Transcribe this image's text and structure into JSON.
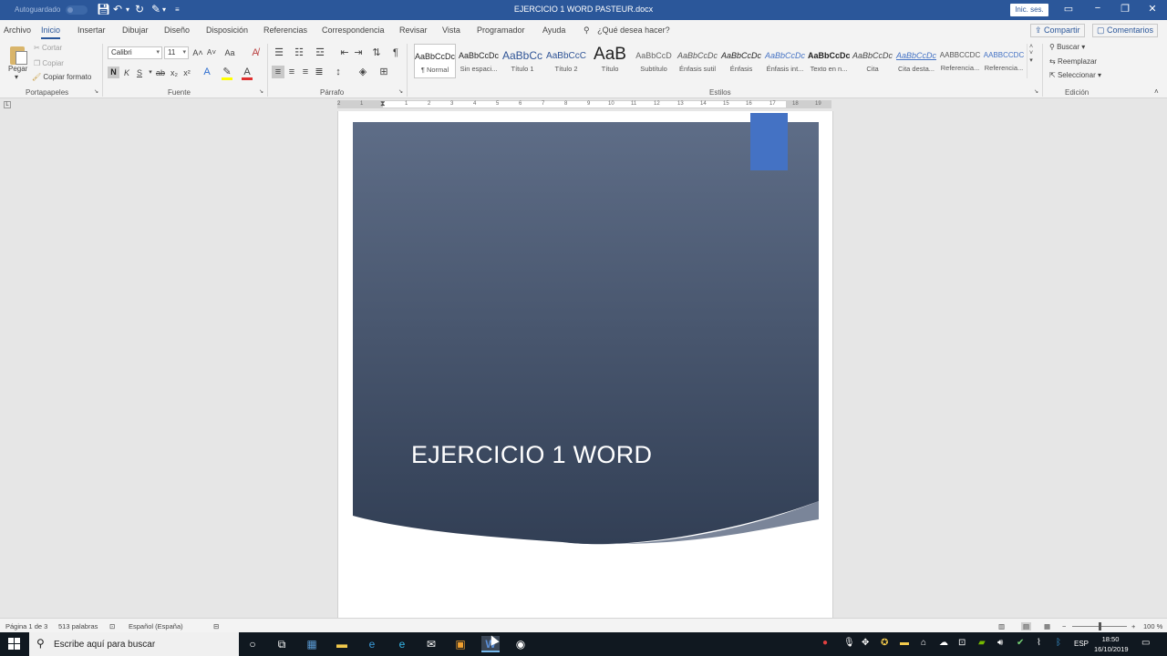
{
  "titlebar": {
    "autosave_label": "Autoguardado",
    "doc_title": "EJERCICIO 1 WORD PASTEUR.docx",
    "signin_label": "Inic. ses."
  },
  "tabs": {
    "items": [
      "Archivo",
      "Inicio",
      "Insertar",
      "Dibujar",
      "Diseño",
      "Disposición",
      "Referencias",
      "Correspondencia",
      "Revisar",
      "Vista",
      "Programador",
      "Ayuda"
    ],
    "active": "Inicio",
    "tell_me": "¿Qué desea hacer?",
    "share": "Compartir",
    "comments": "Comentarios"
  },
  "ribbon": {
    "clipboard": {
      "paste": "Pegar",
      "cut": "Cortar",
      "copy": "Copiar",
      "format_painter": "Copiar formato",
      "group": "Portapapeles"
    },
    "font": {
      "family": "Calibri",
      "size": "11",
      "group": "Fuente",
      "bold": "N",
      "italic": "K",
      "underline": "S"
    },
    "paragraph": {
      "group": "Párrafo"
    },
    "styles": {
      "group": "Estilos",
      "items": [
        {
          "preview": "AaBbCcDc",
          "name": "¶ Normal"
        },
        {
          "preview": "AaBbCcDc",
          "name": "Sin espaci..."
        },
        {
          "preview": "AaBbCc",
          "name": "Título 1"
        },
        {
          "preview": "AaBbCcC",
          "name": "Título 2"
        },
        {
          "preview": "AaB",
          "name": "Título"
        },
        {
          "preview": "AaBbCcD",
          "name": "Subtítulo"
        },
        {
          "preview": "AaBbCcDc",
          "name": "Énfasis sutil"
        },
        {
          "preview": "AaBbCcDc",
          "name": "Énfasis"
        },
        {
          "preview": "AaBbCcDc",
          "name": "Énfasis int..."
        },
        {
          "preview": "AaBbCcDc",
          "name": "Texto en n..."
        },
        {
          "preview": "AaBbCcDc",
          "name": "Cita"
        },
        {
          "preview": "AaBbCcDc",
          "name": "Cita desta..."
        },
        {
          "preview": "AaBbCcDc",
          "name": "Referencia..."
        },
        {
          "preview": "AaBbCcDc",
          "name": "Referencia..."
        }
      ]
    },
    "editing": {
      "find": "Buscar",
      "replace": "Reemplazar",
      "select": "Seleccionar",
      "group": "Edición"
    }
  },
  "ruler": {
    "numbers": [
      "2",
      "1",
      "1",
      "2",
      "3",
      "4",
      "5",
      "6",
      "7",
      "8",
      "9",
      "10",
      "11",
      "12",
      "13",
      "14",
      "15",
      "16",
      "17",
      "18",
      "19"
    ]
  },
  "document": {
    "cover_title": "EJERCICIO 1 WORD"
  },
  "statusbar": {
    "page": "Página 1 de 3",
    "words": "513 palabras",
    "language": "Español (España)",
    "zoom": "100 %"
  },
  "taskbar": {
    "search_placeholder": "Escribe aquí para buscar",
    "language": "ESP",
    "time": "18:50",
    "date": "16/10/2019"
  },
  "colors": {
    "word_blue": "#2b579a",
    "cover_top": "#5e6d87",
    "cover_bottom": "#323f55",
    "accent_tab": "#4472c4"
  }
}
